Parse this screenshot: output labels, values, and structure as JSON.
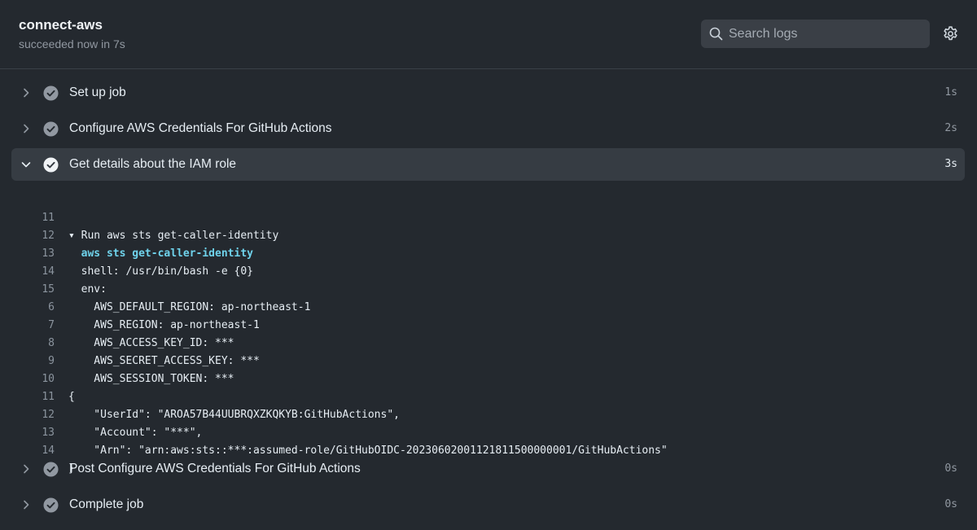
{
  "header": {
    "title": "connect-aws",
    "subtitle": "succeeded now in 7s",
    "search_placeholder": "Search logs"
  },
  "steps": [
    {
      "label": "Set up job",
      "duration": "1s",
      "expanded": false
    },
    {
      "label": "Configure AWS Credentials For GitHub Actions",
      "duration": "2s",
      "expanded": false
    },
    {
      "label": "Get details about the IAM role",
      "duration": "3s",
      "expanded": true
    },
    {
      "label": "Post Configure AWS Credentials For GitHub Actions",
      "duration": "0s",
      "expanded": false
    },
    {
      "label": "Complete job",
      "duration": "0s",
      "expanded": false
    }
  ],
  "log_lines": [
    {
      "n": "11",
      "text": "▾ Run aws sts get-caller-identity",
      "style": "group"
    },
    {
      "n": "12",
      "text": "  aws sts get-caller-identity",
      "style": "cmd"
    },
    {
      "n": "13",
      "text": "  shell: /usr/bin/bash -e {0}",
      "style": "plain"
    },
    {
      "n": "14",
      "text": "  env:",
      "style": "plain"
    },
    {
      "n": "15",
      "text": "    AWS_DEFAULT_REGION: ap-northeast-1",
      "style": "plain"
    },
    {
      "n": "6",
      "text": "    AWS_REGION: ap-northeast-1",
      "style": "plain"
    },
    {
      "n": "7",
      "text": "    AWS_ACCESS_KEY_ID: ***",
      "style": "plain"
    },
    {
      "n": "8",
      "text": "    AWS_SECRET_ACCESS_KEY: ***",
      "style": "plain"
    },
    {
      "n": "9",
      "text": "    AWS_SESSION_TOKEN: ***",
      "style": "plain"
    },
    {
      "n": "10",
      "text": "{",
      "style": "plain"
    },
    {
      "n": "11",
      "text": "    \"UserId\": \"AROA57B44UUBRQXZKQKYB:GitHubActions\",",
      "style": "plain"
    },
    {
      "n": "12",
      "text": "    \"Account\": \"***\",",
      "style": "plain"
    },
    {
      "n": "13",
      "text": "    \"Arn\": \"arn:aws:sts::***:assumed-role/GitHubOIDC-20230602001121811500000001/GitHubActions\"",
      "style": "plain"
    },
    {
      "n": "14",
      "text": "}",
      "style": "plain"
    }
  ],
  "icons": {
    "search": "search-icon",
    "settings": "gear-icon",
    "status": "check-circle-icon",
    "collapsed": "chevron-right-icon",
    "expanded": "chevron-down-icon"
  },
  "colors": {
    "background": "#24292f",
    "expanded_row": "#363c43",
    "command": "#6fd3ec",
    "muted": "#9198a1"
  }
}
